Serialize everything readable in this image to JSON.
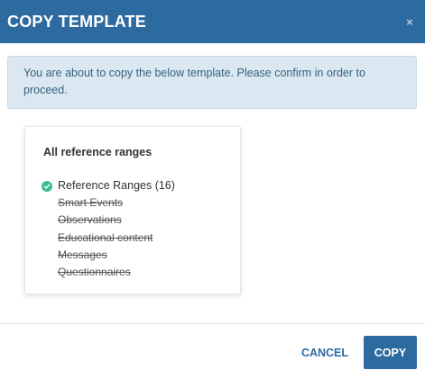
{
  "dialog": {
    "title": "COPY TEMPLATE",
    "close_symbol": "×",
    "info_message": "You are about to copy the below template. Please confirm in order to proceed."
  },
  "card": {
    "title": "All reference ranges",
    "active_item": {
      "label": "Reference Ranges (16)",
      "icon": "check-circle-icon",
      "icon_color": "#3bbf8a"
    },
    "struck_items": [
      "Smart Events",
      "Observations",
      "Educational content",
      "Messages",
      "Questionnaires"
    ]
  },
  "footer": {
    "cancel_label": "CANCEL",
    "copy_label": "COPY"
  },
  "colors": {
    "header_bg": "#2d6a9f",
    "info_bg": "#dbe8f1",
    "primary": "#2d6a9f"
  }
}
